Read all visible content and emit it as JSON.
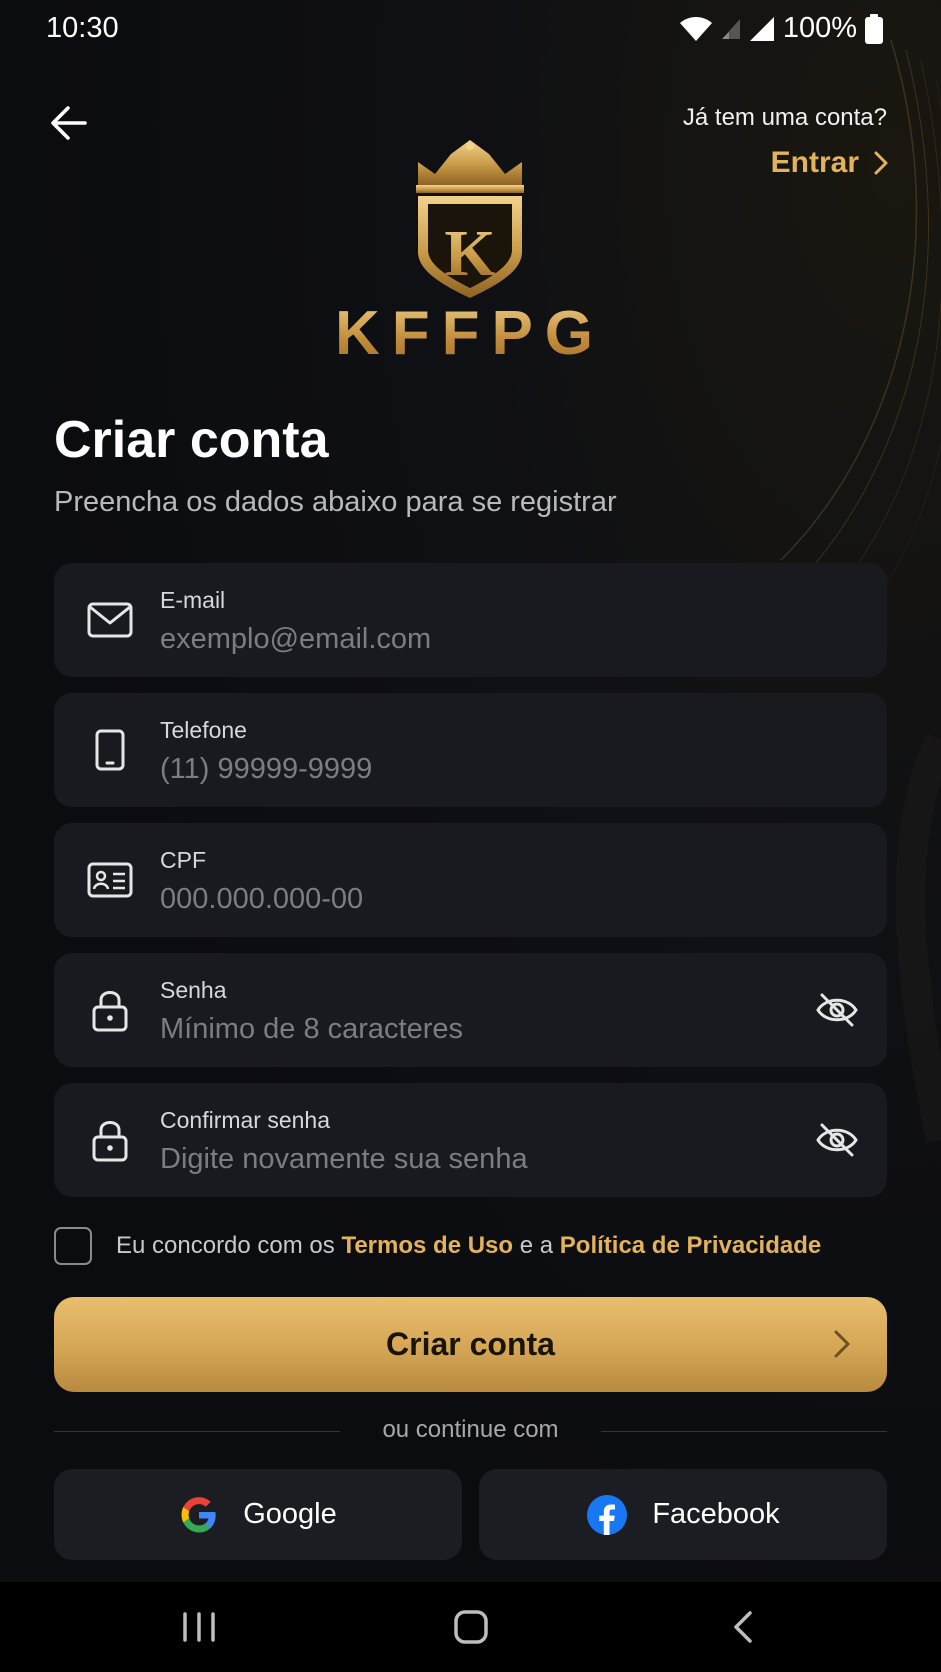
{
  "status_bar": {
    "time": "10:30",
    "battery": "100%"
  },
  "header": {
    "back_icon": "arrow-left-icon",
    "have_account_text": "Já tem uma conta?",
    "login_label": "Entrar"
  },
  "brand": {
    "name": "KFFPG",
    "emblem_letter": "K"
  },
  "page": {
    "title": "Criar conta",
    "subtitle": "Preencha os dados abaixo para se registrar"
  },
  "fields": {
    "email": {
      "label": "E-mail",
      "placeholder": "exemplo@email.com",
      "icon": "envelope-icon"
    },
    "phone": {
      "label": "Telefone",
      "placeholder": "(11) 99999-9999",
      "icon": "smartphone-icon"
    },
    "cpf": {
      "label": "CPF",
      "placeholder": "000.000.000-00",
      "icon": "id-card-icon"
    },
    "password": {
      "label": "Senha",
      "placeholder": "Mínimo de 8 caracteres",
      "icon": "lock-icon"
    },
    "confirm_password": {
      "label": "Confirmar senha",
      "placeholder": "Digite novamente sua senha",
      "icon": "lock-icon"
    }
  },
  "terms": {
    "prefix": "Eu concordo com os",
    "terms_link": "Termos de Uso",
    "middle": "e a",
    "privacy_link": "Política de Privacidade",
    "checked": false
  },
  "primary_button": {
    "label": "Criar conta"
  },
  "divider_text": "ou continue com",
  "social": {
    "google_label": "Google",
    "facebook_label": "Facebook"
  },
  "colors": {
    "accent": "#e2b35c",
    "background": "#0b0c10",
    "field_bg": "#191a1f",
    "button_gold": "#d4a555"
  }
}
